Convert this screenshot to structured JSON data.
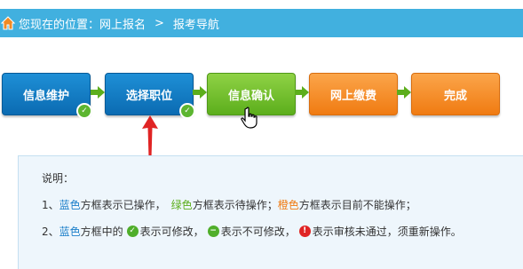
{
  "breadcrumb": {
    "prefix": "您现在的位置：网上报名",
    "separator": ">",
    "current": "报考导航",
    "home_icon": "home-icon"
  },
  "steps": [
    {
      "label": "信息维护",
      "color": "blue",
      "completed": true
    },
    {
      "label": "选择职位",
      "color": "blue",
      "completed": true
    },
    {
      "label": "信息确认",
      "color": "green",
      "completed": false
    },
    {
      "label": "网上缴费",
      "color": "orange",
      "completed": false
    },
    {
      "label": "完成",
      "color": "orange",
      "completed": false
    }
  ],
  "colors": {
    "header_bar": "#41b0df",
    "blue": "#0b6bb2",
    "green": "#5cae1c",
    "orange": "#f07b12",
    "arrow": "#5cae1c",
    "red_pointer": "#e02424",
    "info_bg": "#eef6fc"
  },
  "legend": {
    "title": "说明：",
    "line1": {
      "num": "1、",
      "blue_word": "蓝色",
      "blue_text": "方框表示已操作，",
      "green_word": "绿色",
      "green_text": "方框表示待操作；",
      "orange_word": "橙色",
      "orange_text": "方框表示目前不能操作；"
    },
    "line2": {
      "num": "2、",
      "blue_word": "蓝色",
      "text_a": "方框中的",
      "text_b": "表示可修改，",
      "text_c": "表示不可修改，",
      "text_d": "表示审核未通过，须重新操作。",
      "icons": [
        "check-circle-icon",
        "minus-circle-icon",
        "error-circle-icon"
      ]
    }
  }
}
